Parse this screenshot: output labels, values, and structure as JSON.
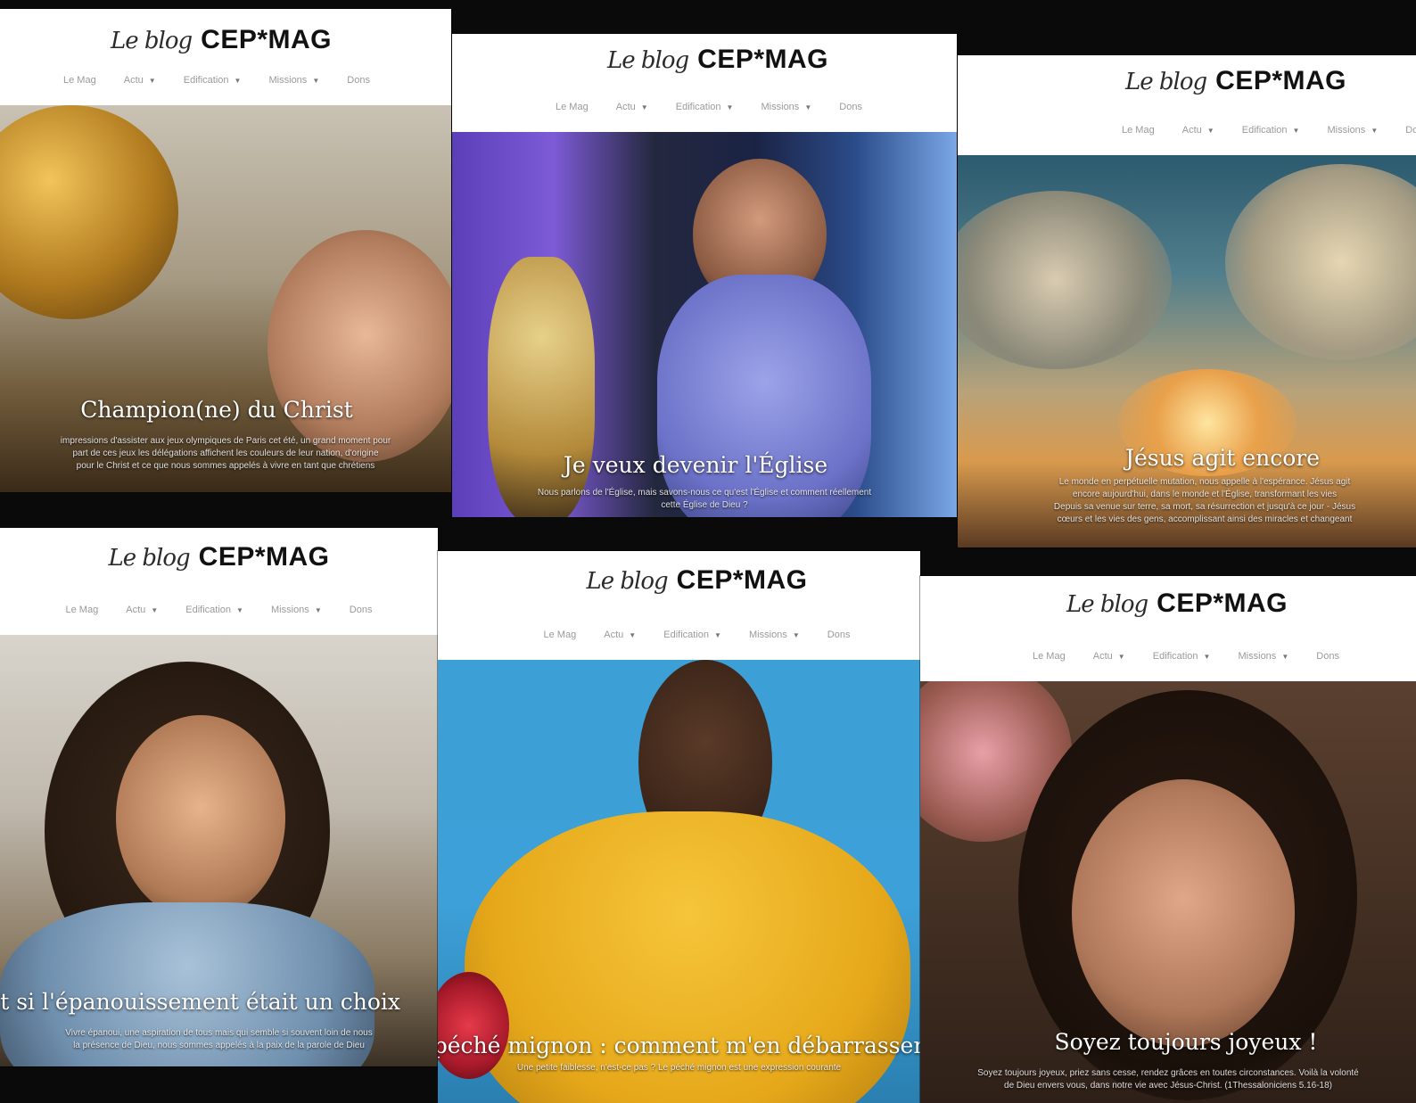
{
  "site": {
    "logo_script": "Le blog",
    "logo_brand": "CEP*MAG",
    "nav": [
      "Le Mag",
      "Actu",
      "Edification",
      "Missions",
      "Dons"
    ]
  },
  "panels": [
    {
      "title": "Champion(ne) du Christ",
      "excerpt_lines": [
        "impressions d'assister aux jeux olympiques de Paris cet été, un grand moment pour",
        "part de ces jeux les délégations affichent les couleurs de leur nation, d'origine",
        "pour le Christ et ce que nous sommes appelés à vivre en tant que chrétiens"
      ]
    },
    {
      "title": "Je veux devenir l'Église",
      "excerpt_lines": [
        "Nous parlons de l'Église, mais savons-nous ce qu'est l'Église et comment réellement",
        "cette Église de Dieu ?"
      ]
    },
    {
      "title": "Jésus agit encore",
      "excerpt_lines": [
        "Le monde en perpétuelle mutation, nous appelle à l'espérance. Jésus agit",
        "encore aujourd'hui, dans le monde et l'Église, transformant les vies",
        "Depuis sa venue sur terre, sa mort, sa résurrection et jusqu'à ce jour - Jésus",
        "cœurs et les vies des gens, accomplissant ainsi des miracles et changeant"
      ]
    },
    {
      "title": "Et si l'épanouissement était un choix",
      "excerpt_lines": [
        "Vivre épanoui, une aspiration de tous mais qui semble si souvent loin de nous",
        "la présence de Dieu, nous sommes appelés à la paix de la parole de Dieu"
      ]
    },
    {
      "title": "Mon péché mignon : comment m'en débarrasser",
      "excerpt_lines": [
        "Une petite faiblesse, n'est-ce pas ? Le péché mignon est une expression courante"
      ]
    },
    {
      "title": "Soyez toujours joyeux !",
      "excerpt_lines": [
        "Soyez toujours joyeux, priez sans cesse, rendez grâces en toutes circonstances. Voilà la volonté",
        "de Dieu envers vous, dans notre vie avec Jésus-Christ. (1Thessaloniciens 5.16-18)"
      ]
    }
  ]
}
